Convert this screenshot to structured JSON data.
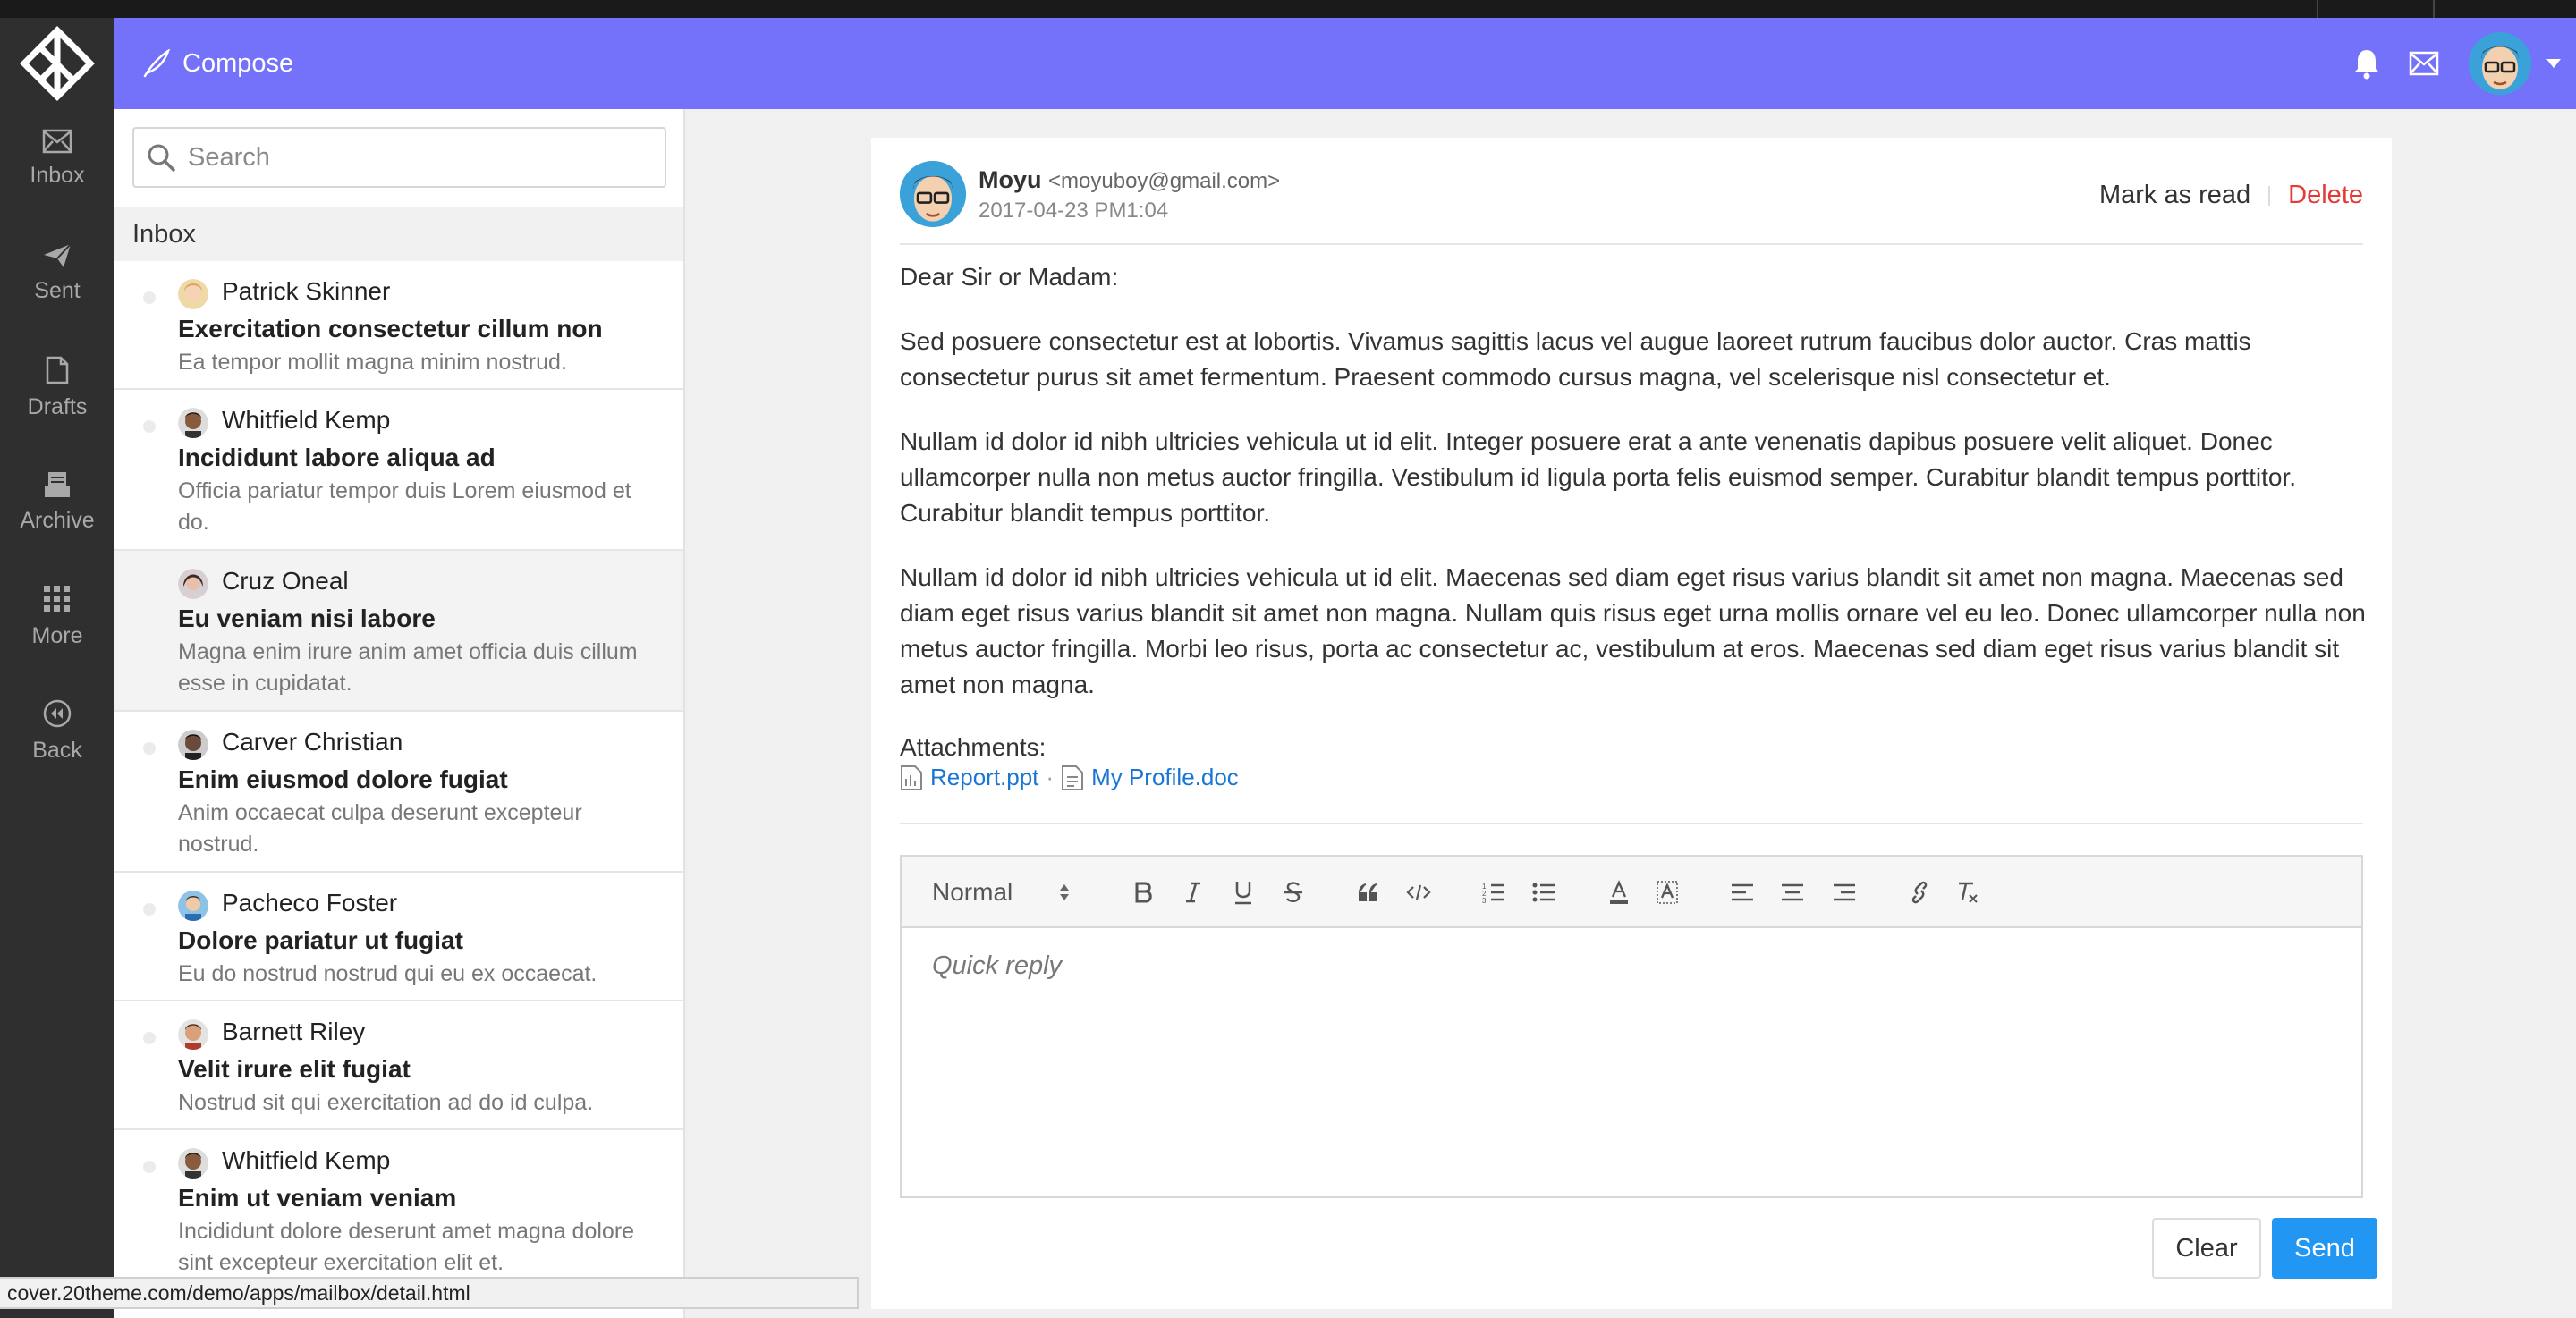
{
  "topbar": {
    "compose_label": "Compose"
  },
  "rail": {
    "items": [
      {
        "label": "Inbox",
        "icon": "inbox-icon"
      },
      {
        "label": "Sent",
        "icon": "send-icon"
      },
      {
        "label": "Drafts",
        "icon": "draft-icon"
      },
      {
        "label": "Archive",
        "icon": "archive-icon"
      },
      {
        "label": "More",
        "icon": "grid-icon"
      },
      {
        "label": "Back",
        "icon": "back-icon"
      }
    ]
  },
  "search": {
    "placeholder": "Search"
  },
  "list": {
    "heading": "Inbox",
    "messages": [
      {
        "name": "Patrick Skinner",
        "subject": "Exercitation consectetur cillum non",
        "excerpt": "Ea tempor mollit magna minim nostrud."
      },
      {
        "name": "Whitfield Kemp",
        "subject": "Incididunt labore aliqua ad",
        "excerpt": "Officia pariatur tempor duis Lorem eiusmod et do."
      },
      {
        "name": "Cruz Oneal",
        "subject": "Eu veniam nisi labore",
        "excerpt": "Magna enim irure anim amet officia duis cillum esse in cupidatat."
      },
      {
        "name": "Carver Christian",
        "subject": "Enim eiusmod dolore fugiat",
        "excerpt": "Anim occaecat culpa deserunt excepteur nostrud."
      },
      {
        "name": "Pacheco Foster",
        "subject": "Dolore pariatur ut fugiat",
        "excerpt": "Eu do nostrud nostrud qui eu ex occaecat."
      },
      {
        "name": "Barnett Riley",
        "subject": "Velit irure elit fugiat",
        "excerpt": "Nostrud sit qui exercitation ad do id culpa."
      },
      {
        "name": "Whitfield Kemp",
        "subject": "Enim ut veniam veniam",
        "excerpt": "Incididunt dolore deserunt amet magna dolore sint excepteur exercitation elit et."
      }
    ]
  },
  "email": {
    "sender_name": "Moyu",
    "sender_email": "<moyuboy@gmail.com>",
    "date": "2017-04-23 PM1:04",
    "mark_read_label": "Mark as read",
    "delete_label": "Delete",
    "greeting": "Dear Sir or Madam:",
    "paragraphs": [
      "Sed posuere consectetur est at lobortis. Vivamus sagittis lacus vel augue laoreet rutrum faucibus dolor auctor. Cras mattis consectetur purus sit amet fermentum. Praesent commodo cursus magna, vel scelerisque nisl consectetur et.",
      "Nullam id dolor id nibh ultricies vehicula ut id elit. Integer posuere erat a ante venenatis dapibus posuere velit aliquet. Donec ullamcorper nulla non metus auctor fringilla. Vestibulum id ligula porta felis euismod semper. Curabitur blandit tempus porttitor. Curabitur blandit tempus porttitor.",
      "Nullam id dolor id nibh ultricies vehicula ut id elit. Maecenas sed diam eget risus varius blandit sit amet non magna. Maecenas sed diam eget risus varius blandit sit amet non magna. Nullam quis risus eget urna mollis ornare vel eu leo. Donec ullamcorper nulla non metus auctor fringilla. Morbi leo risus, porta ac consectetur ac, vestibulum at eros. Maecenas sed diam eget risus varius blandit sit amet non magna."
    ],
    "attachments_label": "Attachments:",
    "attachments": [
      "Report.ppt",
      "My Profile.doc"
    ],
    "attachment_separator": "·"
  },
  "editor": {
    "format_value": "Normal",
    "placeholder": "Quick reply",
    "clear_label": "Clear",
    "send_label": "Send"
  },
  "statusbar": {
    "url": "cover.20theme.com/demo/apps/mailbox/detail.html"
  },
  "colors": {
    "topbar": "#7471fa",
    "rail": "#2f2f2f",
    "send": "#2196f3",
    "delete": "#e53935",
    "link": "#1976d2"
  }
}
